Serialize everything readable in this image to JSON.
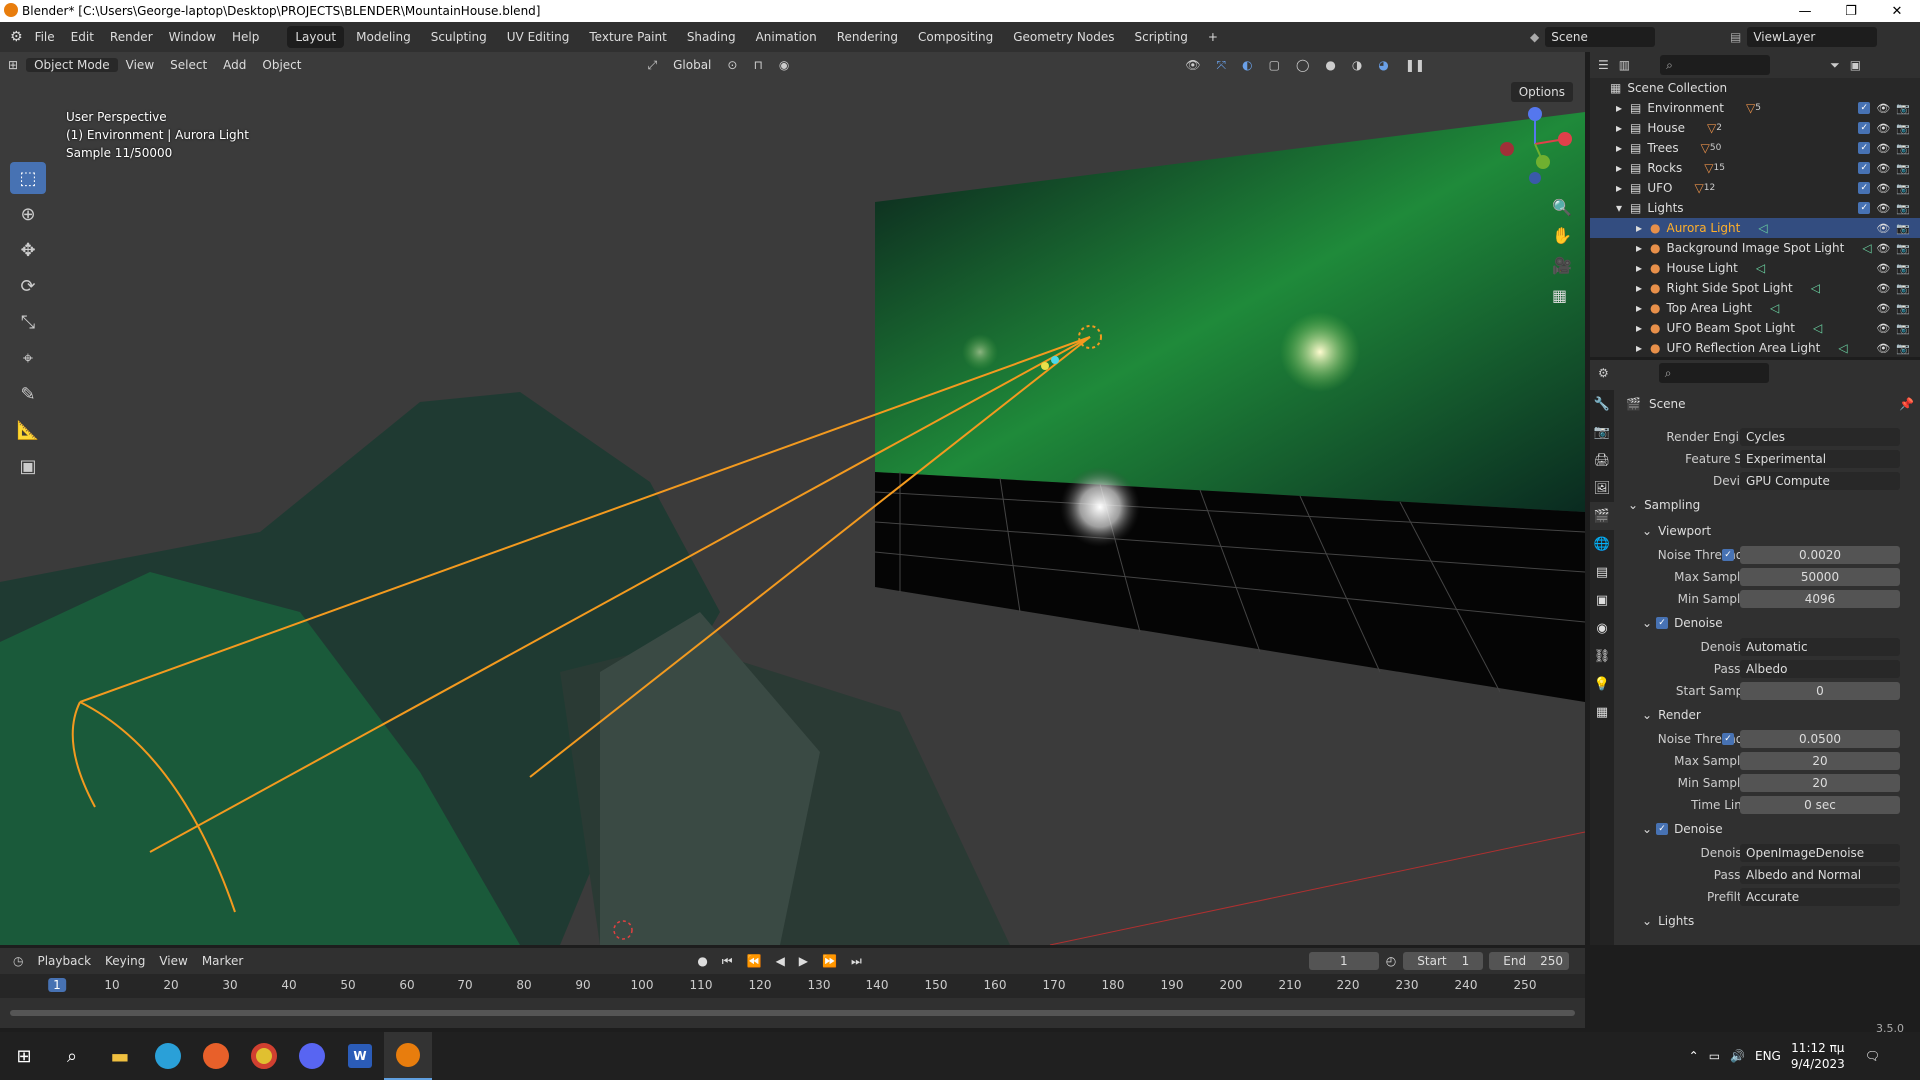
{
  "title": "Blender* [C:\\Users\\George-laptop\\Desktop\\PROJECTS\\BLENDER\\MountainHouse.blend]",
  "menu": [
    "File",
    "Edit",
    "Render",
    "Window",
    "Help"
  ],
  "workspaces": [
    "Layout",
    "Modeling",
    "Sculpting",
    "UV Editing",
    "Texture Paint",
    "Shading",
    "Animation",
    "Rendering",
    "Compositing",
    "Geometry Nodes",
    "Scripting",
    "+"
  ],
  "scene": "Scene",
  "view_layer": "ViewLayer",
  "viewport": {
    "mode": "Object Mode",
    "menus": [
      "View",
      "Select",
      "Add",
      "Object"
    ],
    "orientation": "Global",
    "options": "Options",
    "overlay_line1": "User Perspective",
    "overlay_line2": "(1) Environment | Aurora Light",
    "overlay_line3": "Sample 11/50000"
  },
  "outliner": {
    "root": "Scene Collection",
    "collections": [
      {
        "name": "Environment",
        "count": "5"
      },
      {
        "name": "House",
        "count": "2"
      },
      {
        "name": "Trees",
        "count": "50"
      },
      {
        "name": "Rocks",
        "count": "15"
      },
      {
        "name": "UFO",
        "count": "12"
      },
      {
        "name": "Lights",
        "count": ""
      }
    ],
    "lights": [
      "Aurora Light",
      "Background Image Spot Light",
      "House Light",
      "Right Side Spot Light",
      "Top Area Light",
      "UFO Beam Spot Light",
      "UFO Reflection Area Light"
    ]
  },
  "properties": {
    "context": "Scene",
    "render_engine_label": "Render Engine",
    "render_engine": "Cycles",
    "feature_set_label": "Feature Set",
    "feature_set": "Experimental",
    "device_label": "Device",
    "device": "GPU Compute",
    "sampling": "Sampling",
    "viewport": "Viewport",
    "vp_noise_label": "Noise Threshold",
    "vp_noise": "0.0020",
    "vp_max_label": "Max Samples",
    "vp_max": "50000",
    "vp_min_label": "Min Samples",
    "vp_min": "4096",
    "denoise": "Denoise",
    "vp_denoiser_label": "Denoiser",
    "vp_denoiser": "Automatic",
    "vp_passes_label": "Passes",
    "vp_passes": "Albedo",
    "vp_start_label": "Start Sample",
    "vp_start": "0",
    "render": "Render",
    "r_noise_label": "Noise Threshold",
    "r_noise": "0.0500",
    "r_max_label": "Max Samples",
    "r_max": "20",
    "r_min_label": "Min Samples",
    "r_min": "20",
    "r_time_label": "Time Limit",
    "r_time": "0 sec",
    "r_denoiser_label": "Denoiser",
    "r_denoiser": "OpenImageDenoise",
    "r_passes_label": "Passes",
    "r_passes": "Albedo and Normal",
    "r_prefilter_label": "Prefilter",
    "r_prefilter": "Accurate",
    "lights": "Lights"
  },
  "timeline": {
    "menus": [
      "Playback",
      "Keying",
      "View",
      "Marker"
    ],
    "current_frame": "1",
    "start_label": "Start",
    "start": "1",
    "end_label": "End",
    "end": "250",
    "ticks": [
      "1",
      "10",
      "20",
      "30",
      "40",
      "50",
      "60",
      "70",
      "80",
      "90",
      "100",
      "110",
      "120",
      "130",
      "140",
      "150",
      "160",
      "170",
      "180",
      "190",
      "200",
      "210",
      "220",
      "230",
      "240",
      "250"
    ]
  },
  "version": "3.5.0",
  "taskbar": {
    "lang": "ENG",
    "time": "11:12 πμ",
    "date": "9/4/2023"
  }
}
